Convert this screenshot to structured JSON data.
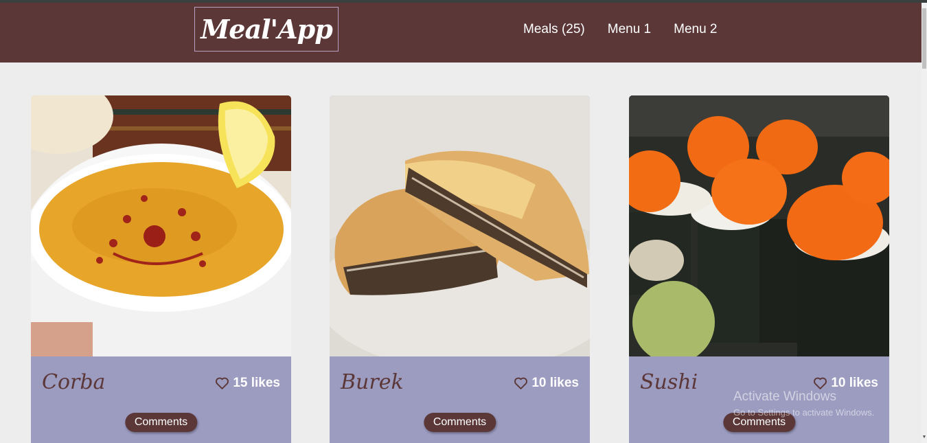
{
  "app": {
    "logo_text": "Meal'App"
  },
  "nav": {
    "items": [
      "Meals (25)",
      "Menu 1",
      "Menu 2"
    ]
  },
  "cards": [
    {
      "name": "Corba",
      "likes": "15 likes",
      "comments_label": "Comments"
    },
    {
      "name": "Burek",
      "likes": "10 likes",
      "comments_label": "Comments"
    },
    {
      "name": "Sushi",
      "likes": "10 likes",
      "comments_label": "Comments"
    }
  ],
  "watermark": {
    "title": "Activate Windows",
    "subtitle": "Go to Settings to activate Windows."
  },
  "colors": {
    "header_bg": "#5b3738",
    "card_info_bg": "#9c9bc0",
    "page_bg": "#ededed",
    "button_bg": "#5b3738"
  }
}
